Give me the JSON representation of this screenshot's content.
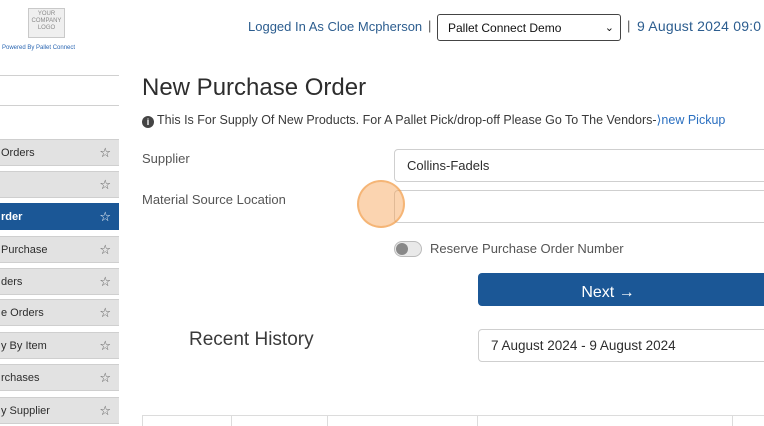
{
  "header": {
    "logo_lines": [
      "YOUR",
      "COMPANY",
      "LOGO"
    ],
    "powered_by": "Powered By Pallet Connect",
    "logged_in_text": "Logged In As Cloe Mcpherson",
    "separator": "|",
    "environment_select": {
      "selected": "Pallet Connect Demo"
    },
    "datetime": "9 August 2024 09:0"
  },
  "sidebar": {
    "items": [
      {
        "label": "Orders",
        "active": false
      },
      {
        "label": "",
        "active": false
      },
      {
        "label": "rder",
        "active": true
      },
      {
        "label": "Purchase",
        "active": false
      },
      {
        "label": "ders",
        "active": false
      },
      {
        "label": "e Orders",
        "active": false
      },
      {
        "label": "y By Item",
        "active": false
      },
      {
        "label": "rchases",
        "active": false
      },
      {
        "label": "y Supplier",
        "active": false
      }
    ]
  },
  "main": {
    "title": "New Purchase Order",
    "info": {
      "icon": "info-icon",
      "text": "This Is For Supply Of New Products. For A Pallet Pick/drop-off Please Go To The Vendors-",
      "link_text": "⟩new Pickup"
    },
    "supplier": {
      "label": "Supplier",
      "value": "Collins-Fadels"
    },
    "material_source": {
      "label": "Material Source Location",
      "value": ""
    },
    "reserve_toggle": {
      "label": "Reserve Purchase Order Number",
      "on": false
    },
    "next_button": {
      "label": "Next →"
    },
    "recent_history": {
      "title": "Recent History",
      "date_range": "7 August 2024 - 9 August 2024"
    }
  },
  "colors": {
    "primary": "#1b5796",
    "link": "#2a6fc0",
    "sidebar_bg": "#e2e2e2",
    "cursor_highlight": "#f7a050"
  }
}
